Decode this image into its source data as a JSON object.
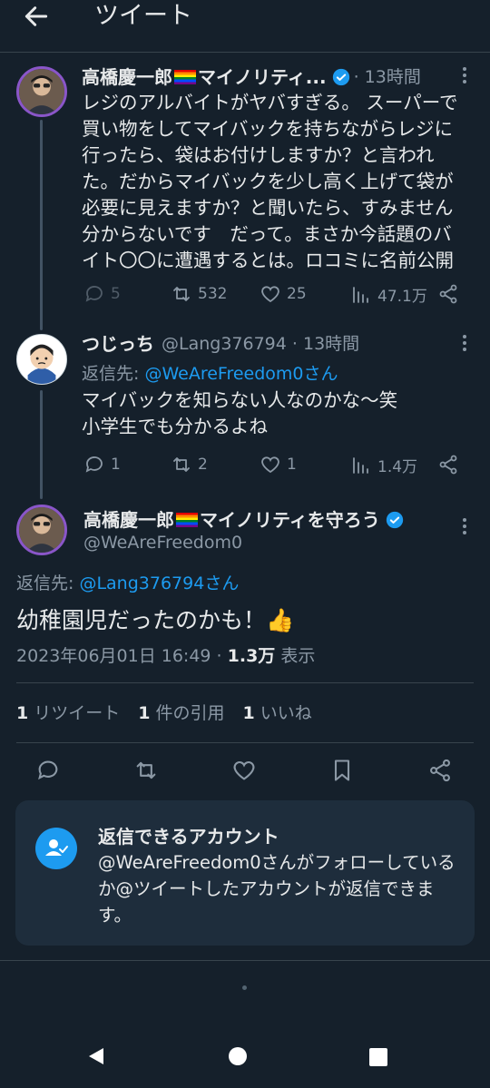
{
  "header": {
    "title": "ツイート"
  },
  "tweet1": {
    "name": "高橋慶一郎",
    "name_suffix": "マイノリティ...",
    "meta": "· 13時間",
    "lines": [
      "レジのアルバイトがヤバすぎる。 スーパーで",
      "買い物をしてマイバックを持ちながらレジに",
      "行ったら、袋はお付けしますか？と言われ",
      "た。だからマイバックを少し高く上げて袋が",
      "必要に見えますか？と聞いたら、すみません",
      "分からないです　だって。まさか今話題のバ",
      "イト〇〇に遭遇するとは。ロコミに名前公開"
    ],
    "stats": {
      "reply": "5",
      "retweet": "532",
      "like": "25",
      "views": "47.1万"
    }
  },
  "tweet2": {
    "name": "つじっち",
    "meta": "@Lang376794 · 13時間",
    "reply_prefix": "返信先: ",
    "reply_target": "@WeAreFreedom0さん",
    "lines": [
      "マイバックを知らない人なのかな〜笑",
      "小学生でも分かるよね"
    ],
    "stats": {
      "reply": "1",
      "retweet": "2",
      "like": "1",
      "views": "1.4万"
    }
  },
  "main": {
    "name": "高橋慶一郎",
    "name_suffix": "マイノリティを守ろう",
    "handle": "@WeAreFreedom0",
    "reply_prefix": "返信先: ",
    "reply_target": "@Lang376794さん",
    "text": "幼稚園児だったのかも！",
    "emoji": "👍",
    "timestamp": "2023年06月01日 16:49 · ",
    "views_count": "1.3万",
    "views_label": " 表示",
    "counts": [
      {
        "num": "1",
        "label": "リツイート"
      },
      {
        "num": "1",
        "label": "件の引用"
      },
      {
        "num": "1",
        "label": "いいね"
      }
    ]
  },
  "card": {
    "title": "返信できるアカウント",
    "body": "@WeAreFreedom0さんがフォローしているか@ツイートしたアカウントが返信できます。"
  },
  "colors": {
    "accent": "#1d9bf0",
    "background": "#15202b",
    "muted": "#8b98a5"
  },
  "icons": [
    "back-arrow-icon",
    "verified-icon",
    "more-icon",
    "reply-icon",
    "retweet-icon",
    "like-icon",
    "views-icon",
    "share-icon",
    "bookmark-icon",
    "person-check-icon",
    "nav-back-icon",
    "nav-home-icon",
    "nav-recents-icon"
  ]
}
